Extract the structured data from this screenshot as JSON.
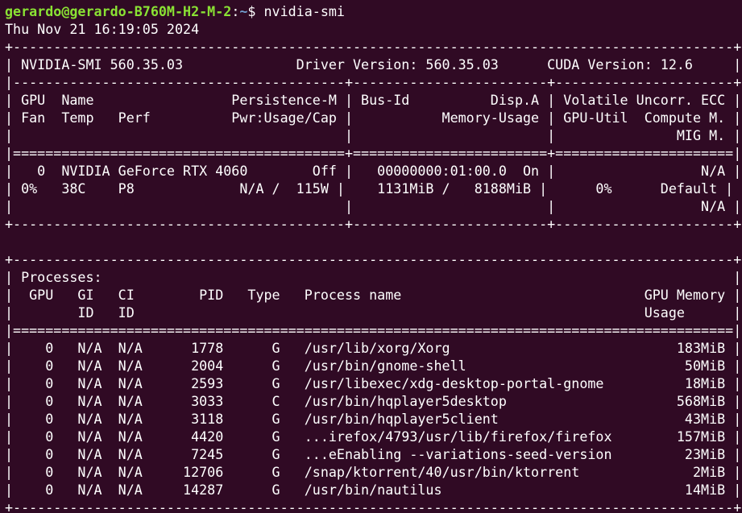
{
  "prompt": {
    "user_host": "gerardo@gerardo-B760M-H2-M-2",
    "colon": ":",
    "path": "~",
    "dollar": "$ ",
    "command": "nvidia-smi"
  },
  "timestamp": "Thu Nov 21 16:19:05 2024",
  "lines": [
    "+-----------------------------------------------------------------------------------------+",
    "| NVIDIA-SMI 560.35.03              Driver Version: 560.35.03      CUDA Version: 12.6     |",
    "|-----------------------------------------+------------------------+----------------------+",
    "| GPU  Name                 Persistence-M | Bus-Id          Disp.A | Volatile Uncorr. ECC |",
    "| Fan  Temp   Perf          Pwr:Usage/Cap |           Memory-Usage | GPU-Util  Compute M. |",
    "|                                         |                        |               MIG M. |",
    "|=========================================+========================+======================|",
    "|   0  NVIDIA GeForce RTX 4060        Off |   00000000:01:00.0  On |                  N/A |",
    "| 0%   38C    P8             N/A /  115W |    1131MiB /   8188MiB |      0%      Default |",
    "|                                         |                        |                  N/A |",
    "+-----------------------------------------+------------------------+----------------------+",
    "",
    "+-----------------------------------------------------------------------------------------+",
    "| Processes:                                                                              |",
    "|  GPU   GI   CI        PID   Type   Process name                              GPU Memory |",
    "|        ID   ID                                                               Usage      |",
    "|=========================================================================================|",
    "|    0   N/A  N/A      1778      G   /usr/lib/xorg/Xorg                            183MiB |",
    "|    0   N/A  N/A      2004      G   /usr/bin/gnome-shell                           50MiB |",
    "|    0   N/A  N/A      2593      G   /usr/libexec/xdg-desktop-portal-gnome          18MiB |",
    "|    0   N/A  N/A      3033      C   /usr/bin/hqplayer5desktop                     568MiB |",
    "|    0   N/A  N/A      3118      G   /usr/bin/hqplayer5client                       43MiB |",
    "|    0   N/A  N/A      4420      G   ...irefox/4793/usr/lib/firefox/firefox        157MiB |",
    "|    0   N/A  N/A      7245      G   ...eEnabling --variations-seed-version         23MiB |",
    "|    0   N/A  N/A     12706      G   /snap/ktorrent/40/usr/bin/ktorrent              2MiB |",
    "|    0   N/A  N/A     14287      G   /usr/bin/nautilus                              14MiB |",
    "+-----------------------------------------------------------------------------------------+"
  ]
}
